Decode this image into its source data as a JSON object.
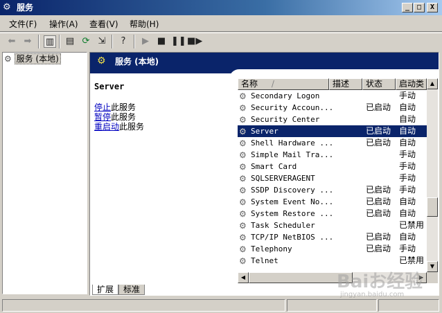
{
  "window": {
    "title": "服务",
    "min_label": "_",
    "max_label": "□",
    "close_label": "X"
  },
  "menu": [
    {
      "label": "文件(F)"
    },
    {
      "label": "操作(A)"
    },
    {
      "label": "查看(V)"
    },
    {
      "label": "帮助(H)"
    }
  ],
  "tree": {
    "root_label": "服务 (本地)"
  },
  "header": {
    "title": "服务 (本地)"
  },
  "description": {
    "service_name": "Server",
    "stop_link": "停止",
    "stop_suffix": "此服务",
    "pause_link": "暂停",
    "pause_suffix": "此服务",
    "restart_link": "重启动",
    "restart_suffix": "此服务"
  },
  "list": {
    "columns": [
      "名称",
      "描述",
      "状态",
      "启动类"
    ],
    "sort_glyph": "/",
    "rows": [
      {
        "name": "Secondary Logon",
        "status": "",
        "startup": "手动"
      },
      {
        "name": "Security Accoun...",
        "status": "已启动",
        "startup": "自动"
      },
      {
        "name": "Security Center",
        "status": "",
        "startup": "自动"
      },
      {
        "name": "Server",
        "status": "已启动",
        "startup": "自动",
        "selected": true
      },
      {
        "name": "Shell Hardware ...",
        "status": "已启动",
        "startup": "自动"
      },
      {
        "name": "Simple Mail Tra...",
        "status": "",
        "startup": "手动"
      },
      {
        "name": "Smart Card",
        "status": "",
        "startup": "手动"
      },
      {
        "name": "SQLSERVERAGENT",
        "status": "",
        "startup": "手动"
      },
      {
        "name": "SSDP Discovery ...",
        "status": "已启动",
        "startup": "手动"
      },
      {
        "name": "System Event No...",
        "status": "已启动",
        "startup": "自动"
      },
      {
        "name": "System Restore ...",
        "status": "已启动",
        "startup": "自动"
      },
      {
        "name": "Task Scheduler",
        "status": "",
        "startup": "已禁用"
      },
      {
        "name": "TCP/IP NetBIOS ...",
        "status": "已启动",
        "startup": "自动"
      },
      {
        "name": "Telephony",
        "status": "已启动",
        "startup": "手动"
      },
      {
        "name": "Telnet",
        "status": "",
        "startup": "已禁用"
      }
    ]
  },
  "tabs": [
    {
      "label": "扩展",
      "active": true
    },
    {
      "label": "标准",
      "active": false
    }
  ],
  "watermark": {
    "brand": "Baiお经验",
    "url": "jingyan.baidu.com"
  },
  "colors": {
    "title_bar": "#0a246a",
    "selection": "#0a246a",
    "link": "#0000c0",
    "face": "#d4d0c8"
  }
}
